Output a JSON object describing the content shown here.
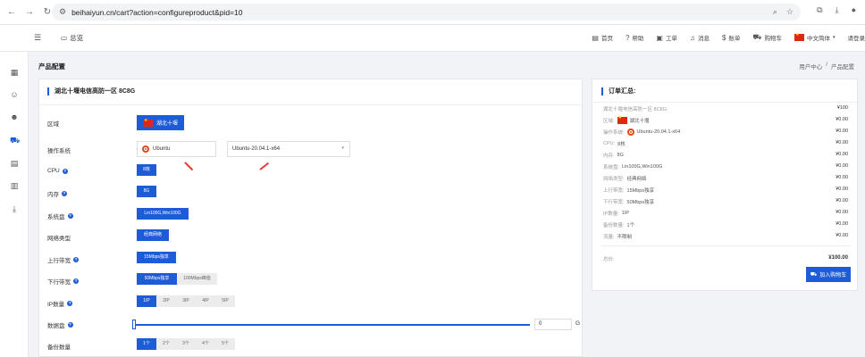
{
  "browser": {
    "url": "beihaiyun.cn/cart?action=configureproduct&pid=10"
  },
  "header": {
    "overview": "总览",
    "nav": [
      {
        "icon": "home-icon",
        "label": "首页"
      },
      {
        "icon": "help-icon",
        "label": "帮助"
      },
      {
        "icon": "ticket-icon",
        "label": "工单"
      },
      {
        "icon": "bell-icon",
        "label": "消息"
      },
      {
        "icon": "bill-icon",
        "label": "账单"
      },
      {
        "icon": "cart-icon",
        "label": "购物车"
      },
      {
        "icon": "flag-cn",
        "label": "中文简体"
      },
      {
        "icon": "",
        "label": "请登录"
      }
    ]
  },
  "page": {
    "title": "产品配置",
    "breadcrumb": [
      "用户中心",
      "/",
      "产品配置"
    ]
  },
  "config": {
    "product_title": "湖北十堰电信高防一区 8C8G",
    "region": {
      "label": "区域",
      "value": "湖北十堰"
    },
    "os": {
      "label": "操作系统",
      "family": "Ubuntu",
      "version": "Ubuntu-20.04.1-x64"
    },
    "cpu": {
      "label": "CPU",
      "value": "8核"
    },
    "memory": {
      "label": "内存",
      "value": "8G"
    },
    "system_disk": {
      "label": "系统盘",
      "value": "Lin100G,Win100G"
    },
    "network_type": {
      "label": "网络类型",
      "value": "经典网络"
    },
    "upload_bw": {
      "label": "上行带宽",
      "value": "15Mbps独享"
    },
    "download_bw": {
      "label": "下行带宽",
      "options": [
        "50Mbps独享",
        "100Mbps峰值"
      ]
    },
    "ip_count": {
      "label": "IP数量",
      "options": [
        "1IP",
        "2IP",
        "3IP",
        "4IP",
        "5IP"
      ]
    },
    "data_disk": {
      "label": "数据盘",
      "value": "0",
      "unit": "G",
      "level": 0
    },
    "backup_count": {
      "label": "备份数量",
      "options": [
        "1个",
        "2个",
        "3个",
        "4个",
        "5个"
      ]
    }
  },
  "order": {
    "title": "订单汇总:",
    "product": "湖北十堰电信高防一区 8C8G:",
    "product_price": "¥100",
    "lines": [
      {
        "key": "区域:",
        "value": "湖北十堰",
        "price": "¥0.00"
      },
      {
        "key": "操作系统:",
        "value": "Ubuntu-20.04.1-x64",
        "price": "¥0.00"
      },
      {
        "key": "CPU:",
        "value": "8核",
        "price": "¥0.00"
      },
      {
        "key": "内存:",
        "value": "8G",
        "price": "¥0.00"
      },
      {
        "key": "系统盘:",
        "value": "Lin100G,Win100G",
        "price": "¥0.00"
      },
      {
        "key": "网络类型:",
        "value": "经典网络",
        "price": "¥0.00"
      },
      {
        "key": "上行带宽:",
        "value": "15Mbps独享",
        "price": "¥0.00"
      },
      {
        "key": "下行带宽:",
        "value": "50Mbps独享",
        "price": "¥0.00"
      },
      {
        "key": "IP数量:",
        "value": "1IP",
        "price": "¥0.00"
      },
      {
        "key": "备份数量:",
        "value": "1个",
        "price": "¥0.00"
      },
      {
        "key": "流量:",
        "value": "不限制",
        "price": "¥0.00"
      }
    ],
    "total_label": "总价:",
    "total": "¥100.00",
    "add_to_cart": "加入购物车"
  }
}
